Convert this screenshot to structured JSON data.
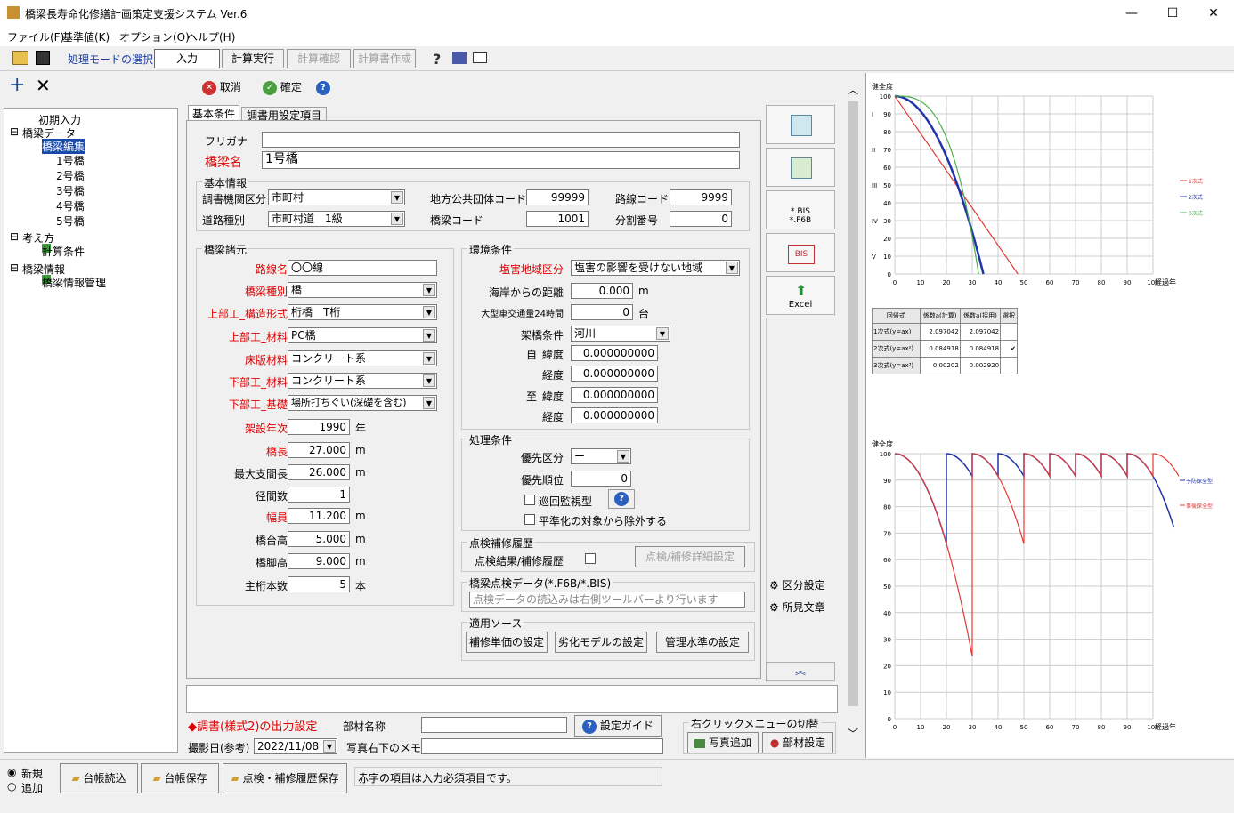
{
  "window": {
    "title": "橋梁長寿命化修繕計画策定支援システム Ver.6",
    "minimize": "—",
    "maximize": "☐",
    "close": "✕"
  },
  "menu": [
    "ファイル(F)",
    "基準値(K)",
    "オプション(O)",
    "ヘルプ(H)"
  ],
  "toolbar": {
    "mode_label": "処理モードの選択",
    "input": "入力",
    "calc_run": "計算実行",
    "calc_check": "計算確認",
    "calc_doc": "計算書作成"
  },
  "left": {
    "tree": {
      "initial": "初期入力",
      "bridge_data": "橋梁データ",
      "bridge_edit": "橋梁編集",
      "b1": "1号橋",
      "b2": "2号橋",
      "b3": "3号橋",
      "b4": "4号橋",
      "b5": "5号橋",
      "approach": "考え方",
      "calc_cond": "計算条件",
      "bridge_info": "橋梁情報",
      "bridge_info_mgmt": "橋梁情報管理"
    }
  },
  "form": {
    "cancel": "取消",
    "confirm": "確定",
    "tabs": [
      "基本条件",
      "調書用設定項目"
    ],
    "furigana_label": "フリガナ",
    "furigana_value": "",
    "bridge_name_label": "橋梁名",
    "bridge_name_value": "1号橋",
    "basic_info": {
      "title": "基本情報",
      "org_label": "調書機関区分",
      "org_value": "市町村",
      "lg_code_label": "地方公共団体コード",
      "lg_code_value": "99999",
      "route_code_label": "路線コード",
      "route_code_value": "9999",
      "road_type_label": "道路種別",
      "road_type_value": "市町村道　1級",
      "bridge_code_label": "橋梁コード",
      "bridge_code_value": "1001",
      "split_no_label": "分割番号",
      "split_no_value": "0"
    },
    "specs": {
      "title": "橋梁諸元",
      "route_label": "路線名",
      "route_value": "〇〇線",
      "type_label": "橋梁種別",
      "type_value": "橋",
      "super_form_label": "上部工_構造形式",
      "super_form_value": "桁橋　T桁",
      "super_mat_label": "上部工_材料",
      "super_mat_value": "PC橋",
      "slab_label": "床版材料",
      "slab_value": "コンクリート系",
      "sub_mat_label": "下部工_材料",
      "sub_mat_value": "コンクリート系",
      "sub_found_label": "下部工_基礎",
      "sub_found_value": "場所打ちぐい(深礎を含む)",
      "year_label": "架設年次",
      "year_value": "1990",
      "year_unit": "年",
      "length_label": "橋長",
      "length_value": "27.000",
      "length_unit": "m",
      "span_label": "最大支間長",
      "span_value": "26.000",
      "span_unit": "m",
      "spans_label": "径間数",
      "spans_value": "1",
      "width_label": "幅員",
      "width_value": "11.200",
      "width_unit": "m",
      "abut_label": "橋台高",
      "abut_value": "5.000",
      "abut_unit": "m",
      "pier_label": "橋脚高",
      "pier_value": "9.000",
      "pier_unit": "m",
      "girders_label": "主桁本数",
      "girders_value": "5",
      "girders_unit": "本"
    },
    "env": {
      "title": "環境条件",
      "salt_label": "塩害地域区分",
      "salt_value": "塩害の影響を受けない地域",
      "coast_label": "海岸からの距離",
      "coast_value": "0.000",
      "coast_unit": "m",
      "traffic_label": "大型車交通量24時間",
      "traffic_value": "0",
      "traffic_unit": "台",
      "cross_label": "架橋条件",
      "cross_value": "河川",
      "from_label": "自",
      "to_label": "至",
      "lat_label": "緯度",
      "lon_label": "経度",
      "from_lat": "0.000000000",
      "from_lon": "0.000000000",
      "to_lat": "0.000000000",
      "to_lon": "0.000000000"
    },
    "proc": {
      "title": "処理条件",
      "priority_label": "優先区分",
      "priority_value": "ー",
      "order_label": "優先順位",
      "order_value": "0",
      "patrol_label": "巡回監視型",
      "exclude_label": "平準化の対象から除外する"
    },
    "history": {
      "title": "点検補修履歴",
      "label": "点検結果/補修履歴",
      "detail_btn": "点検/補修詳細設定"
    },
    "inspection": {
      "title": "橋梁点検データ(*.F6B/*.BIS)",
      "placeholder": "点検データの読込みは右側ツールバーより行います"
    },
    "source": {
      "title": "適用ソース",
      "unit_btn": "補修単価の設定",
      "deg_btn": "劣化モデルの設定",
      "mgmt_btn": "管理水準の設定"
    },
    "report": {
      "title": "◆調書(様式2)の出力設定",
      "part_label": "部材名称",
      "part_value": "",
      "guide_btn": "設定ガイド",
      "date_label": "撮影日(参考)",
      "date_value": "2022/11/08",
      "memo_label": "写真右下のメモ",
      "memo_value": "",
      "switch_title": "右クリックメニューの切替",
      "photo_btn": "写真追加",
      "part_btn": "部材設定"
    }
  },
  "side_tools": {
    "bis": "*.BIS\n*.F6B",
    "bis2": "BIS",
    "excel": "Excel",
    "zone": "区分設定",
    "opinion": "所見文章"
  },
  "bottom": {
    "new": "新規",
    "add": "追加",
    "load": "台帳読込",
    "save": "台帳保存",
    "history_save": "点検・補修履歴保存",
    "status": "赤字の項目は入力必須項目です。"
  },
  "chart_data": [
    {
      "type": "line",
      "title": "",
      "ylabel": "健全度",
      "xlabel": "経過年",
      "ylim": [
        0,
        100
      ],
      "xlim": [
        0,
        100
      ],
      "categories_y": [
        "I",
        "II",
        "III",
        "IV",
        "V"
      ],
      "series": [
        {
          "name": "1次式",
          "color": "#e53935"
        },
        {
          "name": "2次式",
          "color": "#2233aa"
        },
        {
          "name": "3次式",
          "color": "#4caf50"
        }
      ],
      "table": {
        "headers": [
          "回帰式",
          "係数a(計算)",
          "係数a(採用)",
          "選択"
        ],
        "rows": [
          [
            "1次式(y=ax)",
            "2.097042",
            "2.097042",
            ""
          ],
          [
            "2次式(y=ax²)",
            "0.084918",
            "0.084918",
            "✔"
          ],
          [
            "3次式(y=ax³)",
            "0.00202",
            "0.002920",
            ""
          ]
        ]
      }
    },
    {
      "type": "line",
      "title": "",
      "ylabel": "健全度",
      "xlabel": "経過年",
      "ylim": [
        0,
        100
      ],
      "xlim": [
        0,
        100
      ],
      "series": [
        {
          "name": "予防保全型",
          "color": "#2233aa"
        },
        {
          "name": "事後保全型",
          "color": "#e53935"
        }
      ]
    }
  ]
}
